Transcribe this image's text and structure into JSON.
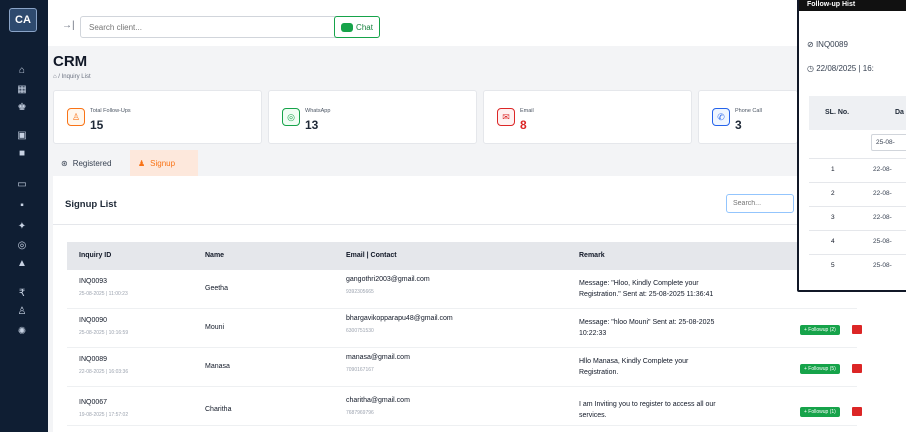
{
  "sidebar": {
    "logo": "CA",
    "icons": [
      "home-icon",
      "grid-icon",
      "team-icon",
      "box-icon",
      "file-icon",
      "calendar-icon",
      "document-icon",
      "star-icon",
      "whatsapp-icon",
      "bell-icon",
      "rupee-icon",
      "users-icon",
      "settings-icon"
    ]
  },
  "topbar": {
    "collapse_glyph": "→|",
    "search_placeholder": "Search client...",
    "chat_label": "Chat"
  },
  "page": {
    "title": "CRM",
    "breadcrumb": "⌂ / Inquiry List"
  },
  "stats": [
    {
      "label": "Total Follow-Ups",
      "value": "15",
      "icon": "user-icon",
      "color": "#f97316"
    },
    {
      "label": "WhatsApp",
      "value": "13",
      "icon": "whatsapp-icon",
      "color": "#16a34a"
    },
    {
      "label": "Email",
      "value": "8",
      "icon": "mail-icon",
      "color": "#dc2626"
    },
    {
      "label": "Phone Call",
      "value": "3",
      "icon": "phone-icon",
      "color": "#2563eb"
    }
  ],
  "tabs": {
    "registered": "Registered",
    "signup": "Signup"
  },
  "list": {
    "title": "Signup List",
    "search_placeholder": "Search...",
    "columns": [
      "Inquiry ID",
      "Name",
      "Email | Contact",
      "Remark"
    ],
    "rows": [
      {
        "id": "INQ0093",
        "datetime": "25-08-2025 | 11:00:23",
        "name": "Geetha",
        "email": "gangothri2003@gmail.com",
        "phone": "9392305665",
        "remark1": "Message: \"Hloo, Kindly Complete your",
        "remark2": "Registration.\" Sent at: 25-08-2025 11:36:41",
        "followup": ""
      },
      {
        "id": "INQ0090",
        "datetime": "25-08-2025 | 10:16:59",
        "name": "Mouni",
        "email": "bhargavikopparapu48@gmail.com",
        "phone": "6300751530",
        "remark1": "Message: \"hloo Mouni\" Sent at: 25-08-2025",
        "remark2": "10:22:33",
        "followup": "+ Followup (2)"
      },
      {
        "id": "INQ0089",
        "datetime": "22-08-2025 | 16:03:36",
        "name": "Manasa",
        "email": "manasa@gmail.com",
        "phone": "7090167167",
        "remark1": "Hllo Manasa, Kindly Complete your",
        "remark2": "Registration.",
        "followup": "+ Followup (5)"
      },
      {
        "id": "INQ0067",
        "datetime": "19-08-2025 | 17:57:02",
        "name": "Charitha",
        "email": "charitha@gmail.com",
        "phone": "7687969796",
        "remark1": "I am Inviting you to register to access all our",
        "remark2": "services.",
        "followup": "+ Followup (1)"
      }
    ]
  },
  "popup": {
    "title": "Follow-up Hist",
    "inquiry": "INQ0089",
    "datetime": "22/08/2025 | 16:",
    "col_sl": "SL. No.",
    "col_date": "Da",
    "rows": [
      {
        "n": "",
        "d": "25-08-"
      },
      {
        "n": "1",
        "d": "22-08-"
      },
      {
        "n": "2",
        "d": "22-08-"
      },
      {
        "n": "3",
        "d": "22-08-"
      },
      {
        "n": "4",
        "d": "25-08-"
      },
      {
        "n": "5",
        "d": "25-08-"
      }
    ]
  }
}
